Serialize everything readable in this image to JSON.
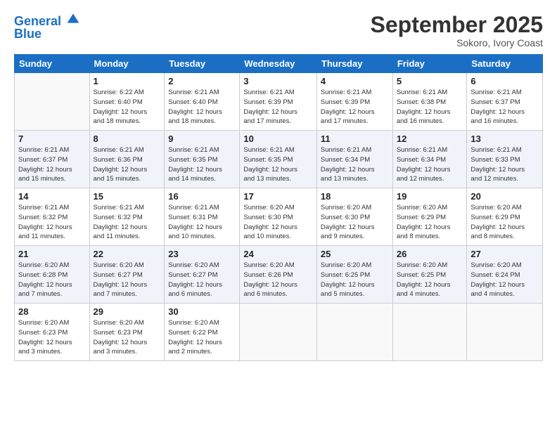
{
  "logo": {
    "line1": "General",
    "line2": "Blue"
  },
  "title": "September 2025",
  "location": "Sokoro, Ivory Coast",
  "days_of_week": [
    "Sunday",
    "Monday",
    "Tuesday",
    "Wednesday",
    "Thursday",
    "Friday",
    "Saturday"
  ],
  "weeks": [
    [
      {
        "num": "",
        "info": ""
      },
      {
        "num": "1",
        "info": "Sunrise: 6:22 AM\nSunset: 6:40 PM\nDaylight: 12 hours\nand 18 minutes."
      },
      {
        "num": "2",
        "info": "Sunrise: 6:21 AM\nSunset: 6:40 PM\nDaylight: 12 hours\nand 18 minutes."
      },
      {
        "num": "3",
        "info": "Sunrise: 6:21 AM\nSunset: 6:39 PM\nDaylight: 12 hours\nand 17 minutes."
      },
      {
        "num": "4",
        "info": "Sunrise: 6:21 AM\nSunset: 6:39 PM\nDaylight: 12 hours\nand 17 minutes."
      },
      {
        "num": "5",
        "info": "Sunrise: 6:21 AM\nSunset: 6:38 PM\nDaylight: 12 hours\nand 16 minutes."
      },
      {
        "num": "6",
        "info": "Sunrise: 6:21 AM\nSunset: 6:37 PM\nDaylight: 12 hours\nand 16 minutes."
      }
    ],
    [
      {
        "num": "7",
        "info": "Sunrise: 6:21 AM\nSunset: 6:37 PM\nDaylight: 12 hours\nand 15 minutes."
      },
      {
        "num": "8",
        "info": "Sunrise: 6:21 AM\nSunset: 6:36 PM\nDaylight: 12 hours\nand 15 minutes."
      },
      {
        "num": "9",
        "info": "Sunrise: 6:21 AM\nSunset: 6:35 PM\nDaylight: 12 hours\nand 14 minutes."
      },
      {
        "num": "10",
        "info": "Sunrise: 6:21 AM\nSunset: 6:35 PM\nDaylight: 12 hours\nand 13 minutes."
      },
      {
        "num": "11",
        "info": "Sunrise: 6:21 AM\nSunset: 6:34 PM\nDaylight: 12 hours\nand 13 minutes."
      },
      {
        "num": "12",
        "info": "Sunrise: 6:21 AM\nSunset: 6:34 PM\nDaylight: 12 hours\nand 12 minutes."
      },
      {
        "num": "13",
        "info": "Sunrise: 6:21 AM\nSunset: 6:33 PM\nDaylight: 12 hours\nand 12 minutes."
      }
    ],
    [
      {
        "num": "14",
        "info": "Sunrise: 6:21 AM\nSunset: 6:32 PM\nDaylight: 12 hours\nand 11 minutes."
      },
      {
        "num": "15",
        "info": "Sunrise: 6:21 AM\nSunset: 6:32 PM\nDaylight: 12 hours\nand 11 minutes."
      },
      {
        "num": "16",
        "info": "Sunrise: 6:21 AM\nSunset: 6:31 PM\nDaylight: 12 hours\nand 10 minutes."
      },
      {
        "num": "17",
        "info": "Sunrise: 6:20 AM\nSunset: 6:30 PM\nDaylight: 12 hours\nand 10 minutes."
      },
      {
        "num": "18",
        "info": "Sunrise: 6:20 AM\nSunset: 6:30 PM\nDaylight: 12 hours\nand 9 minutes."
      },
      {
        "num": "19",
        "info": "Sunrise: 6:20 AM\nSunset: 6:29 PM\nDaylight: 12 hours\nand 8 minutes."
      },
      {
        "num": "20",
        "info": "Sunrise: 6:20 AM\nSunset: 6:29 PM\nDaylight: 12 hours\nand 8 minutes."
      }
    ],
    [
      {
        "num": "21",
        "info": "Sunrise: 6:20 AM\nSunset: 6:28 PM\nDaylight: 12 hours\nand 7 minutes."
      },
      {
        "num": "22",
        "info": "Sunrise: 6:20 AM\nSunset: 6:27 PM\nDaylight: 12 hours\nand 7 minutes."
      },
      {
        "num": "23",
        "info": "Sunrise: 6:20 AM\nSunset: 6:27 PM\nDaylight: 12 hours\nand 6 minutes."
      },
      {
        "num": "24",
        "info": "Sunrise: 6:20 AM\nSunset: 6:26 PM\nDaylight: 12 hours\nand 6 minutes."
      },
      {
        "num": "25",
        "info": "Sunrise: 6:20 AM\nSunset: 6:25 PM\nDaylight: 12 hours\nand 5 minutes."
      },
      {
        "num": "26",
        "info": "Sunrise: 6:20 AM\nSunset: 6:25 PM\nDaylight: 12 hours\nand 4 minutes."
      },
      {
        "num": "27",
        "info": "Sunrise: 6:20 AM\nSunset: 6:24 PM\nDaylight: 12 hours\nand 4 minutes."
      }
    ],
    [
      {
        "num": "28",
        "info": "Sunrise: 6:20 AM\nSunset: 6:23 PM\nDaylight: 12 hours\nand 3 minutes."
      },
      {
        "num": "29",
        "info": "Sunrise: 6:20 AM\nSunset: 6:23 PM\nDaylight: 12 hours\nand 3 minutes."
      },
      {
        "num": "30",
        "info": "Sunrise: 6:20 AM\nSunset: 6:22 PM\nDaylight: 12 hours\nand 2 minutes."
      },
      {
        "num": "",
        "info": ""
      },
      {
        "num": "",
        "info": ""
      },
      {
        "num": "",
        "info": ""
      },
      {
        "num": "",
        "info": ""
      }
    ]
  ]
}
